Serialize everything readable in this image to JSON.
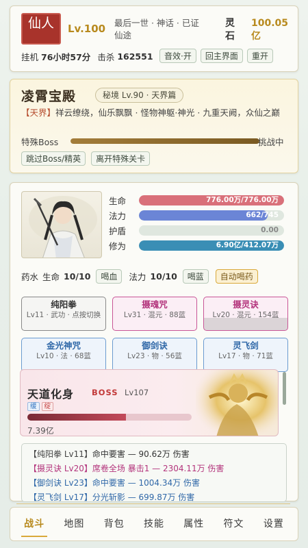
{
  "header": {
    "realm_badge": "仙人",
    "level": "Lv.100",
    "description": "最后一世 · 神话 · 已证仙途",
    "stone_label": "灵石",
    "stone_value": "100.05亿",
    "idle_label": "挂机",
    "idle_time": "76小时57分",
    "kills_label": "击杀",
    "kills_value": "162551",
    "buttons": {
      "sound": "音效·开",
      "main": "回主界面",
      "restart": "重开"
    }
  },
  "dungeon": {
    "title": "凌霄宝殿",
    "tag": "秘境 Lv.90 · 天界篇",
    "desc_prefix": "【天界】",
    "desc_text": "祥云缭绕，仙乐飘飘 · 怪物神躯·神光 · 九重天阙，众仙之巅",
    "boss_label": "特殊Boss",
    "boss_progress": 1.0,
    "boss_state": "挑战中",
    "buttons": {
      "skip": "跳过Boss/精英",
      "leave": "离开特殊关卡"
    }
  },
  "character": {
    "stats": [
      {
        "name": "生命",
        "value": "776.00万/776.00万",
        "fraction": 1.0,
        "color": "#d9707a"
      },
      {
        "name": "法力",
        "value": "662/745",
        "fraction": 0.889,
        "color": "#6b85d6"
      },
      {
        "name": "护盾",
        "value": "0.00",
        "fraction": 0.0,
        "color": "#9ab09a"
      },
      {
        "name": "修为",
        "value": "6.90亿/412.07万",
        "fraction": 1.0,
        "color": "#3a8eb5"
      }
    ],
    "potion": {
      "label": "药水",
      "hp_label": "生命",
      "hp_count": "10/10",
      "hp_button": "喝血",
      "mp_label": "法力",
      "mp_count": "10/10",
      "mp_button": "喝蓝",
      "auto_button": "自动喝药"
    },
    "skills": [
      {
        "name": "纯阳拳",
        "info": "Lv11 · 武功 · 点按切换",
        "style": "gray"
      },
      {
        "name": "摄魂咒",
        "info": "Lv31 · 混元 · 88蓝",
        "style": "pink"
      },
      {
        "name": "摄灵诀",
        "info": "Lv20 · 混元 · 154蓝",
        "style": "pink",
        "cooldown": true
      },
      {
        "name": "金光神咒",
        "info": "Lv10 · 法 · 68蓝",
        "style": "blue"
      },
      {
        "name": "御剑诀",
        "info": "Lv23 · 物 · 56蓝",
        "style": "blue"
      },
      {
        "name": "灵飞剑",
        "info": "Lv17 · 物 · 71蓝",
        "style": "blue"
      }
    ],
    "boss": {
      "name": "天道化身",
      "tag": "BOSS",
      "level": "Lv107",
      "debuffs": [
        "缓",
        "绽"
      ],
      "hp_fraction": 0.6,
      "hp_value": "7.39亿"
    },
    "log": [
      {
        "skill": "【纯阳拳 Lv11】",
        "text": "命中要害 — 90.62万 伤害",
        "style": "gray"
      },
      {
        "skill": "【摄灵诀 Lv20】",
        "text": "席卷全场 暴击1 — 2304.11万 伤害",
        "style": "pink"
      },
      {
        "skill": "【御剑诀 Lv23】",
        "text": "命中要害 — 1004.34万 伤害",
        "style": "blue"
      },
      {
        "skill": "【灵飞剑 Lv17】",
        "text": "分光斩影 — 699.87万 伤害",
        "style": "blue"
      }
    ]
  },
  "nav": [
    "战斗",
    "地图",
    "背包",
    "技能",
    "属性",
    "符文",
    "设置"
  ],
  "nav_active": 0
}
